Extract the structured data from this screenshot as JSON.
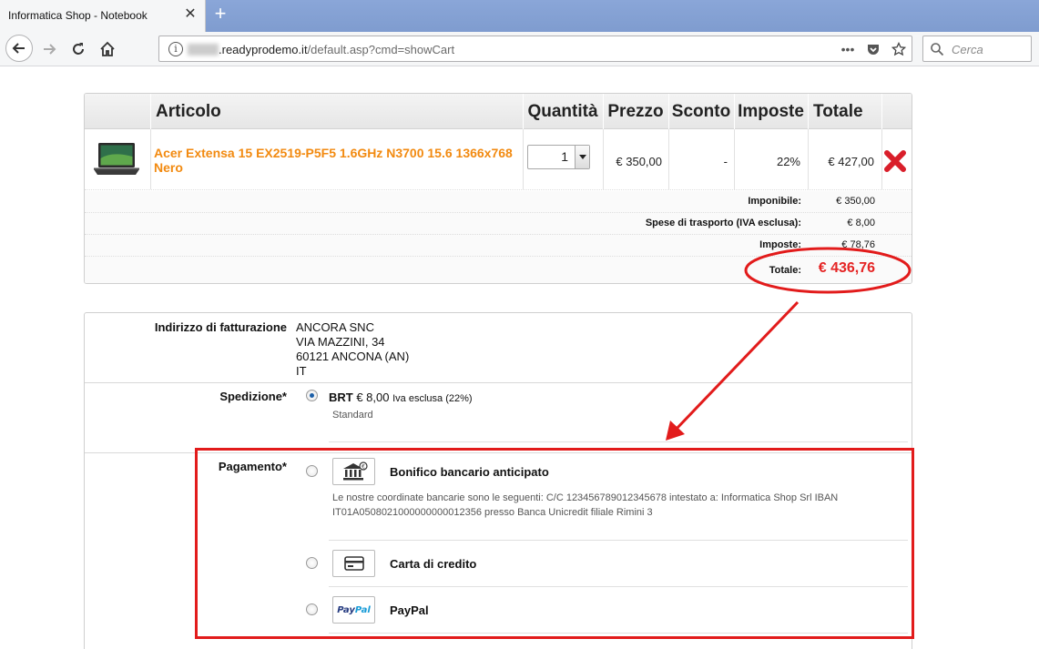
{
  "browser": {
    "tab_title": "Informatica Shop - Notebook",
    "url_domain": ".readyprodemo.it",
    "url_path": "/default.asp?cmd=showCart",
    "search_placeholder": "Cerca"
  },
  "cart": {
    "headers": {
      "article": "Articolo",
      "quantity": "Quantità",
      "price": "Prezzo",
      "discount": "Sconto",
      "taxes": "Imposte",
      "total": "Totale"
    },
    "item": {
      "name": "Acer Extensa 15 EX2519-P5F5 1.6GHz N3700 15.6 1366x768 Nero",
      "quantity": "1",
      "price": "€ 350,00",
      "discount": "-",
      "tax_rate": "22%",
      "total": "€ 427,00"
    },
    "summary": {
      "taxable_label": "Imponibile:",
      "taxable_value": "€ 350,00",
      "shipping_label": "Spese di trasporto (IVA esclusa):",
      "shipping_value": "€ 8,00",
      "taxes_label": "Imposte:",
      "taxes_value": "€ 78,76",
      "total_label": "Totale:",
      "total_value": "€ 436,76"
    }
  },
  "checkout": {
    "billing_label": "Indirizzo di fatturazione",
    "billing_address": [
      "ANCORA SNC",
      "VIA MAZZINI, 34",
      "60121 ANCONA (AN)",
      "IT"
    ],
    "shipping_label": "Spedizione*",
    "shipping_option": {
      "name": "BRT",
      "price": "€ 8,00",
      "vat_note": "Iva esclusa (22%)",
      "description": "Standard",
      "selected": true
    },
    "payment_label": "Pagamento*",
    "payment_options": [
      {
        "name": "Bonifico bancario anticipato",
        "icon": "bank-icon",
        "description": "Le nostre coordinate bancarie sono le seguenti: C/C 123456789012345678 intestato a: Informatica Shop Srl IBAN IT01A0508021000000000012356 presso Banca Unicredit filiale Rimini 3"
      },
      {
        "name": "Carta di credito",
        "icon": "credit-card-icon"
      },
      {
        "name": "PayPal",
        "icon": "paypal-icon",
        "logo_text_1": "Pay",
        "logo_text_2": "Pal"
      }
    ]
  },
  "colors": {
    "product_link": "#f28a10",
    "total_red": "#e52424",
    "annotation_red": "#e21b1b",
    "radio_selected": "#1c5fa8"
  }
}
